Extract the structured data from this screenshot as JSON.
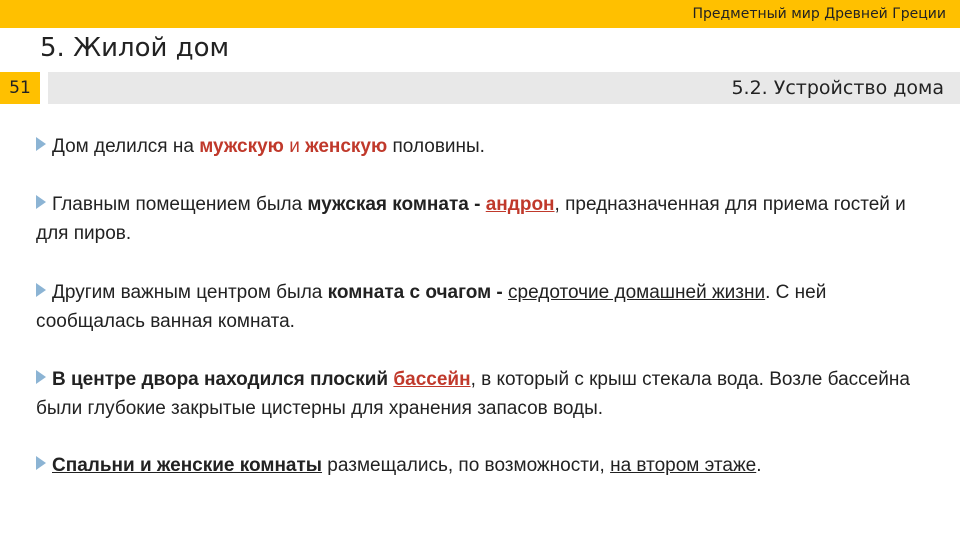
{
  "header": {
    "course_title": "Предметный мир Древней Греции",
    "section_title": "5. Жилой дом",
    "slide_number": "51",
    "subtitle": "5.2. Устройство дома"
  },
  "paragraphs": [
    {
      "p1_a": "Дом делился на ",
      "p1_b": "мужскую",
      "p1_c": " и ",
      "p1_d": "женскую",
      "p1_e": " половины."
    },
    {
      "p2_a": "Главным помещением была ",
      "p2_b": "мужская комната - ",
      "p2_c": "андрон",
      "p2_d": ", предназначенная для приема гостей и для пиров."
    },
    {
      "p3_a": "Другим важным центром была ",
      "p3_b": "комната с очагом - ",
      "p3_c": "средоточие домашней жизни",
      "p3_d": ". С ней сообщалась ванная комната."
    },
    {
      "p4_a": "В центре двора находился плоский ",
      "p4_b": "бассейн",
      "p4_c": ", в который с крыш стекала вода. Возле бассейна были глубокие закрытые цистерны для хранения запасов воды."
    },
    {
      "p5_a": "Спальни и женские комнаты",
      "p5_b": " размещались, по возможности, ",
      "p5_c": "на втором этаже",
      "p5_d": "."
    }
  ],
  "icons": {
    "bullet": "triangle-bullet-icon"
  },
  "colors": {
    "accent": "#FFC000",
    "bar": "#E8E8E8",
    "highlight": "#C0392B",
    "bullet": "#8CB4D4"
  }
}
